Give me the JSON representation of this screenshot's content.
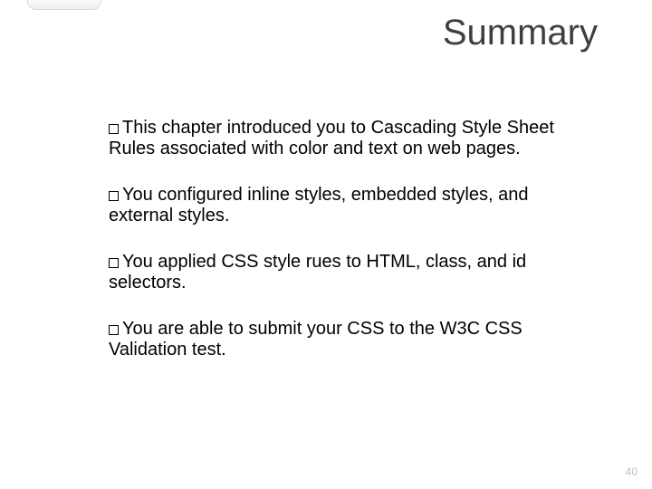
{
  "title": "Summary",
  "bullets": [
    "This chapter introduced you to Cascading Style Sheet Rules associated with color and text on web pages.",
    "You configured inline styles, embedded styles, and external styles.",
    "You applied CSS style rues to HTML, class, and id selectors.",
    "You are able to submit your CSS to the W3C CSS Validation test."
  ],
  "page_number": "40"
}
